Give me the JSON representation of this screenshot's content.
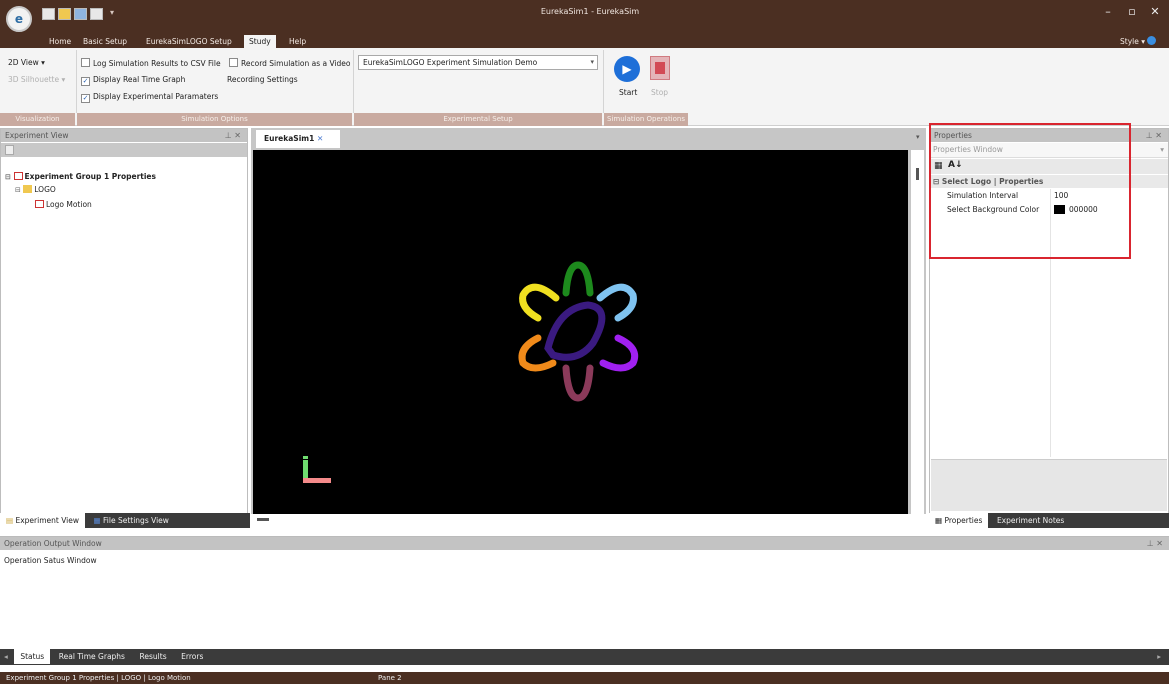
{
  "window": {
    "title": "EurekaSim1 - EurekaSim",
    "app_logo": "e",
    "style_menu": "Style"
  },
  "ribbon_tabs": [
    "Home",
    "Basic Setup",
    "EurekaSimLOGO Setup",
    "Study",
    "Help"
  ],
  "ribbon": {
    "view_2d": "2D View",
    "view_3d": "3D Silhouette",
    "log_csv": "Log Simulation Results to CSV File",
    "log_csv_checked": false,
    "display_graph": "Display Real Time Graph",
    "display_graph_checked": true,
    "display_params": "Display Experimental Paramaters",
    "display_params_checked": true,
    "record_video": "Record Simulation as a Video",
    "record_video_checked": false,
    "recording_settings": "Recording Settings",
    "experiment_select": "EurekaSimLOGO Experiment Simulation Demo",
    "start": "Start",
    "stop": "Stop",
    "groups": [
      "Visualization",
      "Simulation Options",
      "Experimental Setup",
      "Simulation Operations"
    ]
  },
  "experiment_view": {
    "title": "Experiment View",
    "tree": {
      "root": "Experiment Group 1 Properties",
      "folder": "LOGO",
      "leaf": "Logo Motion"
    },
    "tabs": [
      "Experiment View",
      "File Settings View"
    ]
  },
  "document": {
    "tab": "EurekaSim1",
    "background": "#000000",
    "logo_colors": [
      "#1d8a1d",
      "#7fc3f0",
      "#a020f0",
      "#8b3a5a",
      "#f08a1a",
      "#f0e020",
      "#3a1a80"
    ]
  },
  "properties": {
    "title": "Properties",
    "window_label": "Properties Window",
    "category": "Select Logo | Properties",
    "rows": [
      {
        "name": "Simulation Interval",
        "value": "100"
      },
      {
        "name": "Select Background Color",
        "value": "000000"
      }
    ],
    "tabs": [
      "Properties",
      "Experiment Notes"
    ]
  },
  "output": {
    "title": "Operation Output Window",
    "body": "Operation Satus Window",
    "tabs": [
      "Status",
      "Real Time Graphs",
      "Results",
      "Errors"
    ]
  },
  "status": {
    "path": "Experiment Group 1 Properties | LOGO | Logo Motion",
    "pane2": "Pane 2"
  },
  "colors": {
    "title_bar": "#4b2f22",
    "group_label": "#c9aaa0",
    "highlight": "#d9252f",
    "start_button": "#1e6fd8",
    "stop_button": "#d24a55"
  }
}
